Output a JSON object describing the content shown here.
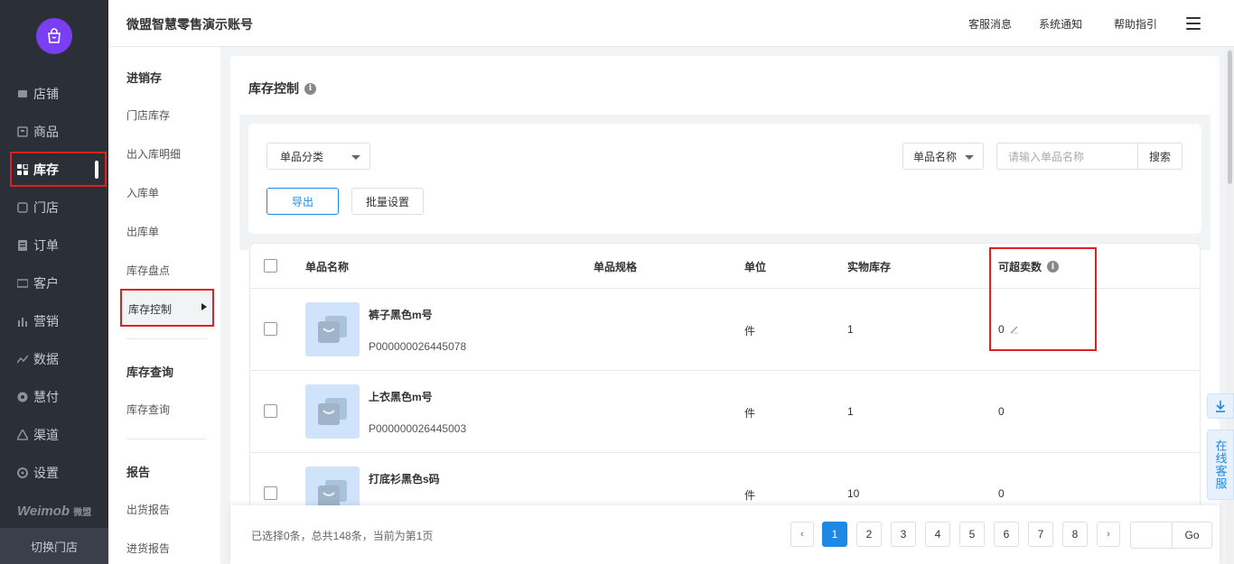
{
  "header": {
    "account": "微盟智慧零售演示账号",
    "links": [
      "客服消息",
      "系统通知",
      "帮助指引"
    ]
  },
  "nav": {
    "items": [
      {
        "label": "店铺",
        "icon": "shop-icon"
      },
      {
        "label": "商品",
        "icon": "goods-icon"
      },
      {
        "label": "库存",
        "icon": "inventory-icon",
        "active": true
      },
      {
        "label": "门店",
        "icon": "store-icon"
      },
      {
        "label": "订单",
        "icon": "order-icon"
      },
      {
        "label": "客户",
        "icon": "customer-icon"
      },
      {
        "label": "营销",
        "icon": "marketing-icon"
      },
      {
        "label": "数据",
        "icon": "data-icon"
      },
      {
        "label": "慧付",
        "icon": "pay-icon"
      },
      {
        "label": "渠道",
        "icon": "channel-icon"
      },
      {
        "label": "设置",
        "icon": "settings-icon"
      }
    ],
    "brand": "Weimob",
    "brand_cn": "微盟",
    "switch_store": "切换门店"
  },
  "submenu": {
    "group1_title": "进销存",
    "group1_items": [
      "门店库存",
      "出入库明细",
      "入库单",
      "出库单",
      "库存盘点"
    ],
    "active_item": "库存控制",
    "group2_title": "库存查询",
    "group2_items": [
      "库存查询"
    ],
    "group3_title": "报告",
    "group3_items": [
      "出货报告",
      "进货报告"
    ]
  },
  "panel": {
    "title": "库存控制"
  },
  "filter": {
    "category_select": "单品分类",
    "name_select": "单品名称",
    "search_placeholder": "请输入单品名称",
    "search_button": "搜索",
    "export_button": "导出",
    "batch_button": "批量设置"
  },
  "table": {
    "headers": {
      "name": "单品名称",
      "spec": "单品规格",
      "unit": "单位",
      "stock": "实物库存",
      "oversell": "可超卖数"
    },
    "rows": [
      {
        "name": "裤子黑色m号",
        "code": "P000000026445078",
        "spec": "",
        "unit": "件",
        "stock": "1",
        "oversell": "0"
      },
      {
        "name": "上衣黑色m号",
        "code": "P000000026445003",
        "spec": "",
        "unit": "件",
        "stock": "1",
        "oversell": "0"
      },
      {
        "name": "打底衫黑色s码",
        "code": "",
        "spec": "",
        "unit": "件",
        "stock": "10",
        "oversell": "0"
      }
    ]
  },
  "footer": {
    "info": "已选择0条，总共148条，当前为第1页",
    "prev": "‹",
    "next": "›",
    "pages": [
      "1",
      "2",
      "3",
      "4",
      "5",
      "6",
      "7",
      "8"
    ],
    "current_page": "1",
    "go_button": "Go"
  },
  "float": {
    "customer_service": "在线客服"
  },
  "colors": {
    "primary": "#1e88e5",
    "highlight": "#e02020",
    "nav_bg": "#2b2f38",
    "logo": "#7b3ff2"
  }
}
